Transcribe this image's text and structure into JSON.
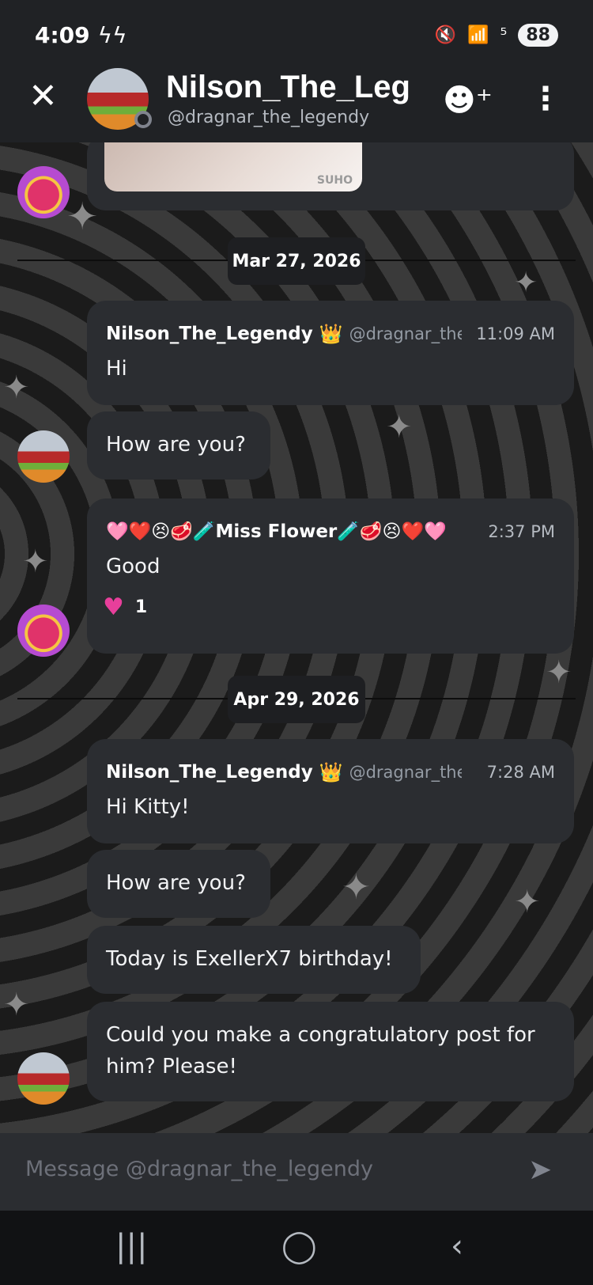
{
  "status_bar": {
    "time": "4:09",
    "flash_icons": "ϟϟ",
    "network": "⁵",
    "battery": "88"
  },
  "header": {
    "name": "Nilson_The_Legendy",
    "handle": "@dragnar_the_legendy"
  },
  "messages": [
    {
      "type": "image",
      "watermark": "SUHO"
    },
    {
      "type": "date",
      "label": "Mar 27, 2026"
    },
    {
      "author": "Nilson_The_Legendy",
      "crown": "👑",
      "handle": "@dragnar_the_legendy",
      "time": "11:09 AM",
      "text": "Hi"
    },
    {
      "text": "How are you?"
    },
    {
      "author": "🩷❤️😣🥩🧪Miss Flower🧪🥩😣❤️🩷",
      "time": "2:37 PM",
      "text": "Good",
      "reaction_count": "1"
    },
    {
      "type": "date",
      "label": "Apr 29, 2026"
    },
    {
      "author": "Nilson_The_Legendy",
      "crown": "👑",
      "handle": "@dragnar_the_legendy",
      "time": "7:28 AM",
      "text": "Hi Kitty!"
    },
    {
      "text": "How are you?"
    },
    {
      "text": "Today is ExellerX7 birthday!"
    },
    {
      "text": "Could you make a congratulatory post for\nhim? Please!"
    }
  ],
  "composer": {
    "placeholder": "Message @dragnar_the_legendy"
  },
  "icons": {
    "close": "close-icon",
    "add_friend": "add-friend-icon",
    "more": "more-vertical-icon",
    "send": "send-icon",
    "nav_recents": "recents-icon",
    "nav_home": "home-icon",
    "nav_back": "back-icon"
  }
}
